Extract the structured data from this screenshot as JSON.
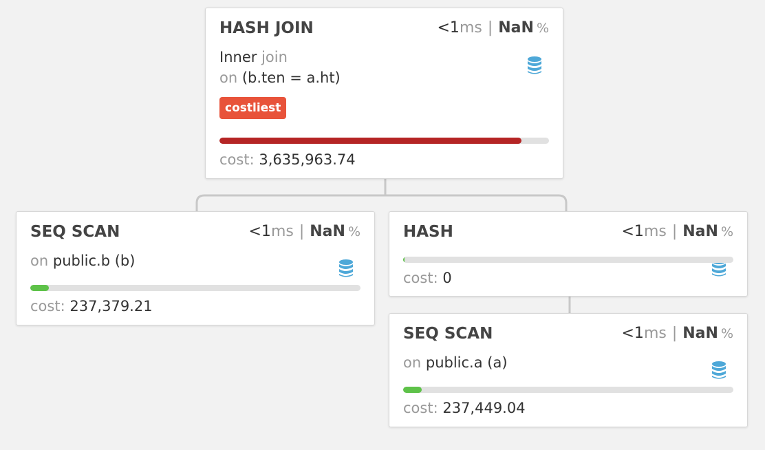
{
  "colors": {
    "background": "#f2f2f2",
    "card": "#ffffff",
    "connector": "#c8c8c8",
    "bar_track": "#e1e1e1",
    "bar_costly": "#b52525",
    "bar_cheap": "#5ec249",
    "badge": "#e8533a",
    "icon": "#4ea8d8",
    "muted_text": "#999999"
  },
  "nodes": {
    "hash_join": {
      "title": "HASH JOIN",
      "time_value": "<1",
      "time_unit": "ms",
      "separator": "|",
      "pct_value": "NaN",
      "pct_sign": "%",
      "join_type": "Inner",
      "join_word": "join",
      "on_label": "on",
      "condition": "(b.ten = a.ht)",
      "badge": "costliest",
      "cost_label": "cost:",
      "cost_value": "3,635,963.74",
      "cost_fraction": 0.917,
      "icon": "database-icon"
    },
    "seq_scan_b": {
      "title": "SEQ SCAN",
      "time_value": "<1",
      "time_unit": "ms",
      "separator": "|",
      "pct_value": "NaN",
      "pct_sign": "%",
      "on_label": "on",
      "relation": "public.b (b)",
      "cost_label": "cost:",
      "cost_value": "237,379.21",
      "cost_fraction": 0.056,
      "icon": "database-icon"
    },
    "hash": {
      "title": "HASH",
      "time_value": "<1",
      "time_unit": "ms",
      "separator": "|",
      "pct_value": "NaN",
      "pct_sign": "%",
      "cost_label": "cost:",
      "cost_value": "0",
      "cost_fraction": 0.004,
      "icon": "database-icon"
    },
    "seq_scan_a": {
      "title": "SEQ SCAN",
      "time_value": "<1",
      "time_unit": "ms",
      "separator": "|",
      "pct_value": "NaN",
      "pct_sign": "%",
      "on_label": "on",
      "relation": "public.a (a)",
      "cost_label": "cost:",
      "cost_value": "237,449.04",
      "cost_fraction": 0.056,
      "icon": "database-icon"
    }
  }
}
